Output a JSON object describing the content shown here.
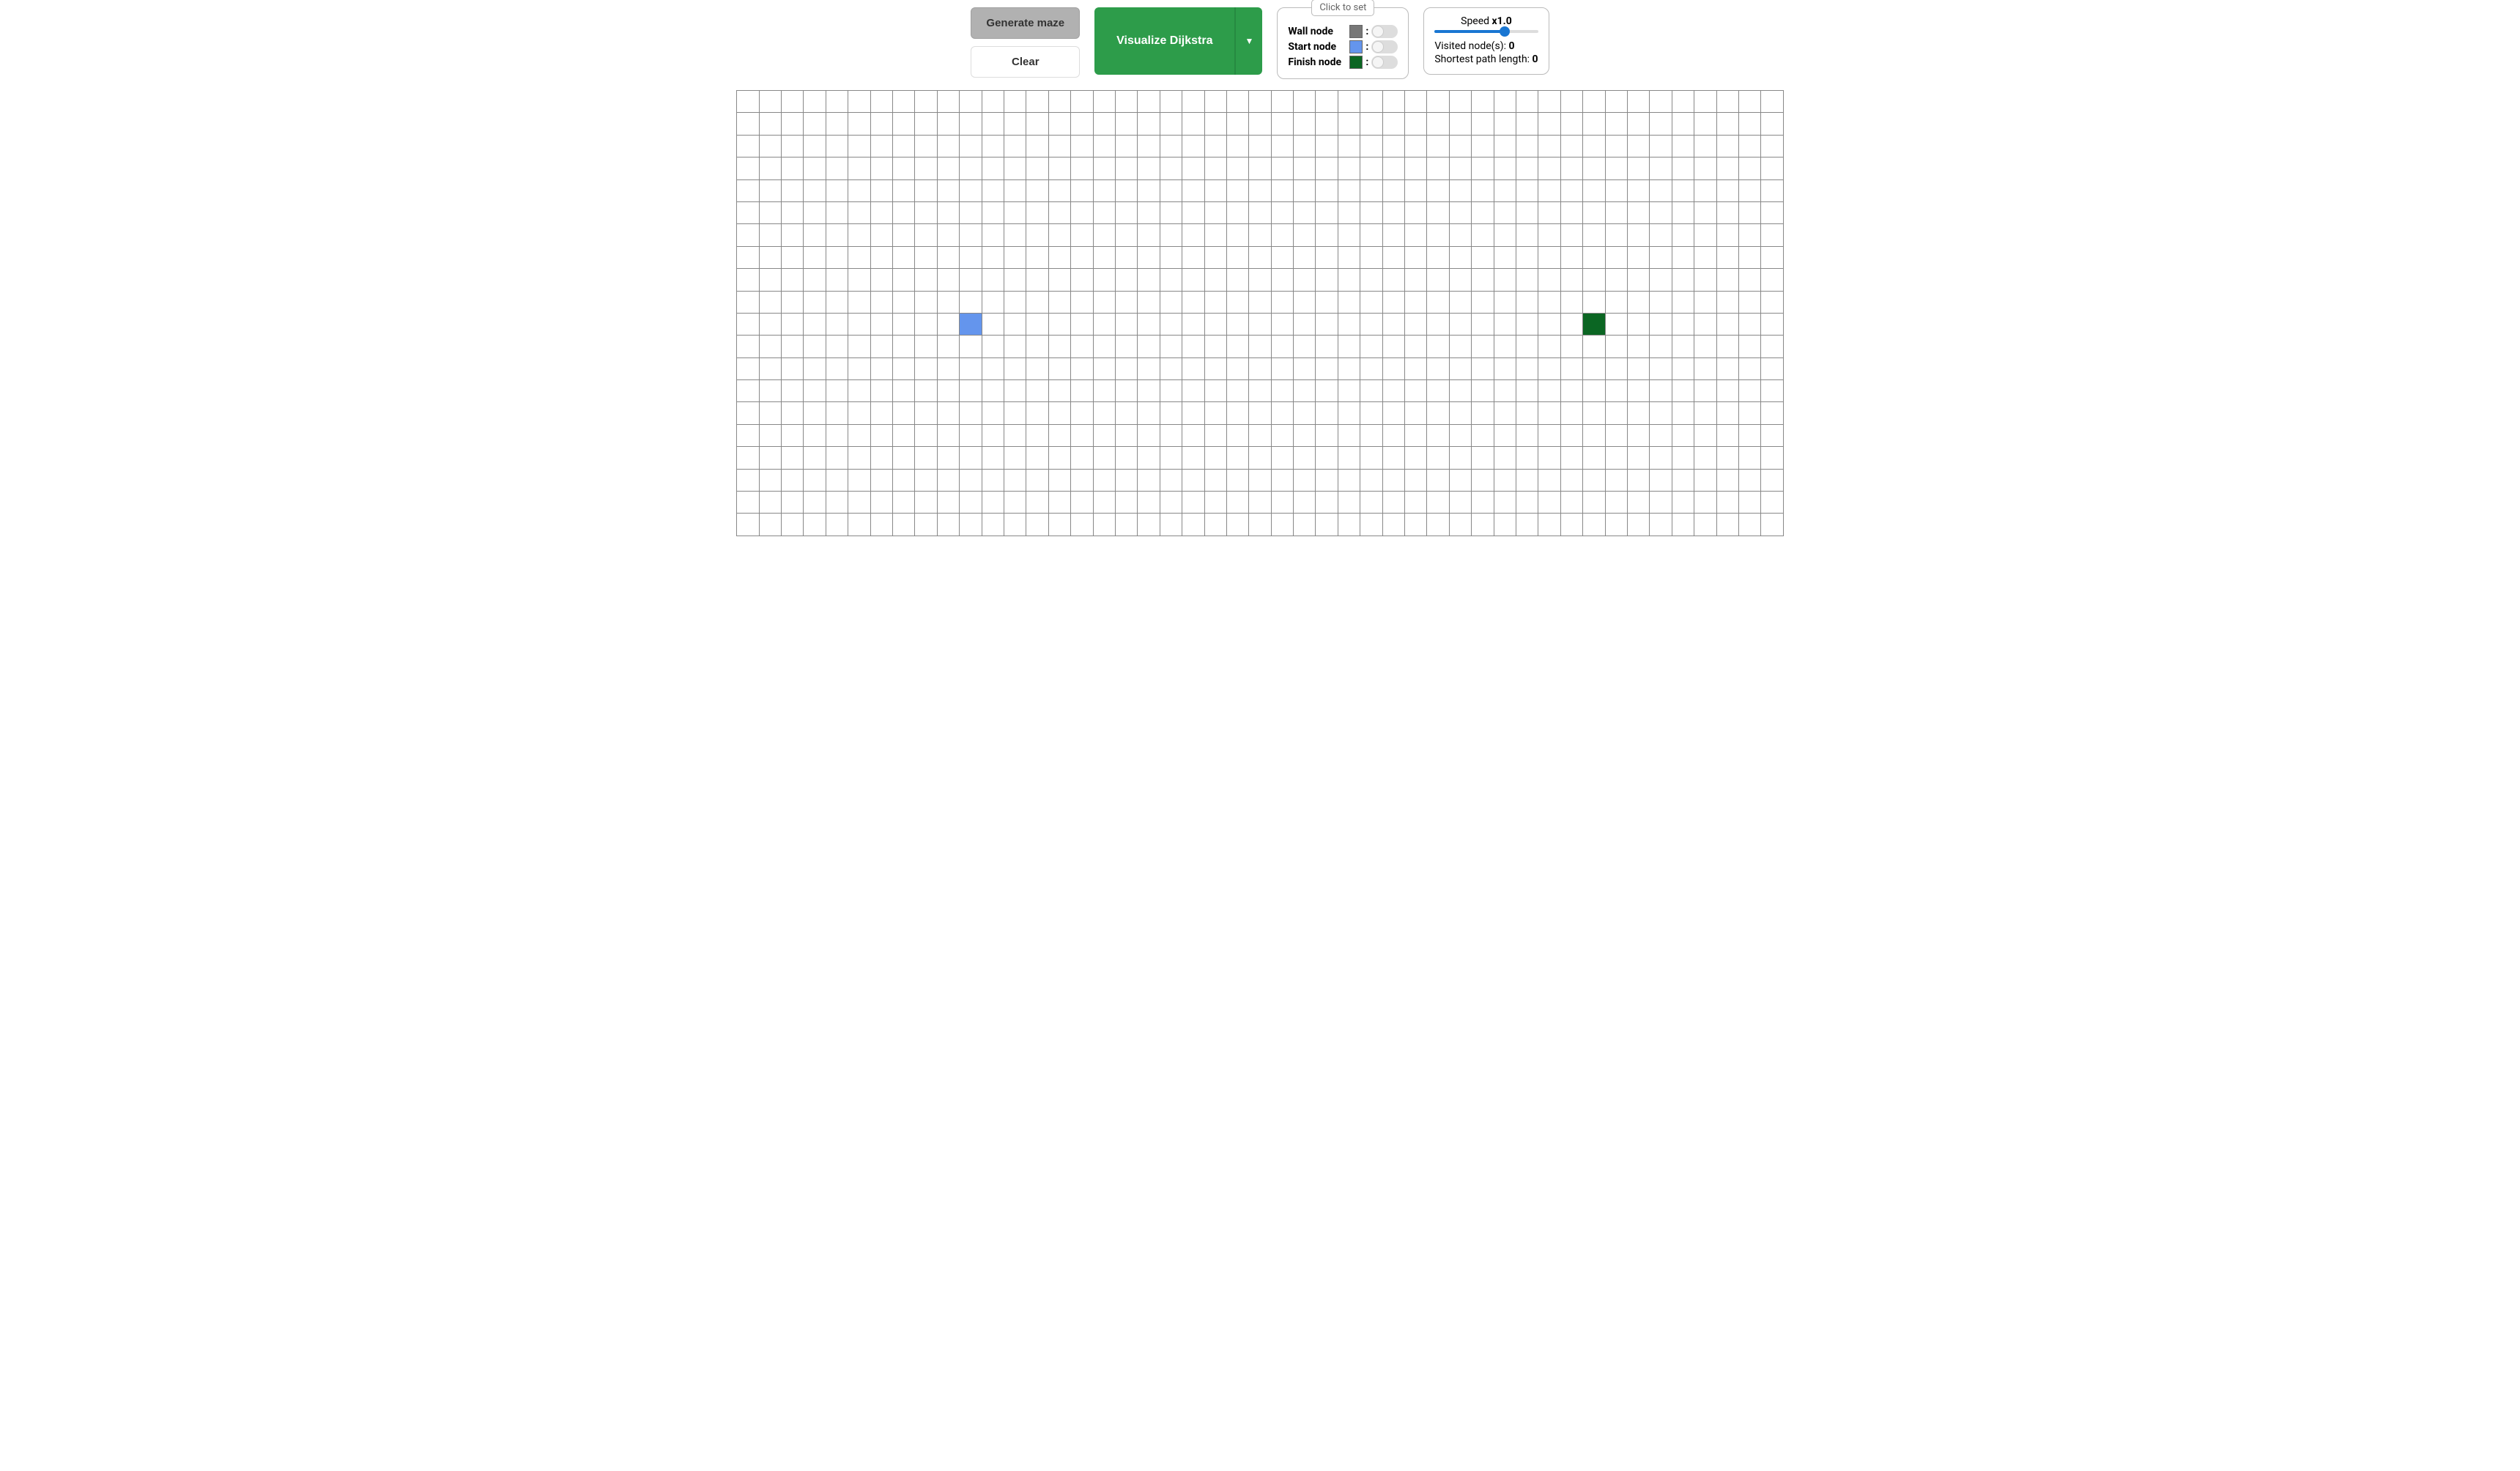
{
  "toolbar": {
    "generate_label": "Generate maze",
    "clear_label": "Clear",
    "visualize_label": "Visualize Dijkstra",
    "dropdown_icon": "▼"
  },
  "legend": {
    "header": "Click to set",
    "wall_label": "Wall node",
    "start_label": "Start node",
    "finish_label": "Finish node",
    "colon": ":"
  },
  "info": {
    "speed_label": "Speed",
    "speed_value": "x1.0",
    "slider_value": 70,
    "visited_label": "Visited node(s): ",
    "visited_value": "0",
    "shortest_label": "Shortest path length: ",
    "shortest_value": "0"
  },
  "grid": {
    "rows": 20,
    "cols": 47,
    "start": {
      "row": 10,
      "col": 10
    },
    "finish": {
      "row": 10,
      "col": 38
    }
  },
  "colors": {
    "wall": "#777777",
    "start": "#6495ed",
    "finish": "#0b6623",
    "accent": "#2d9c4a",
    "slider": "#1976d2"
  }
}
